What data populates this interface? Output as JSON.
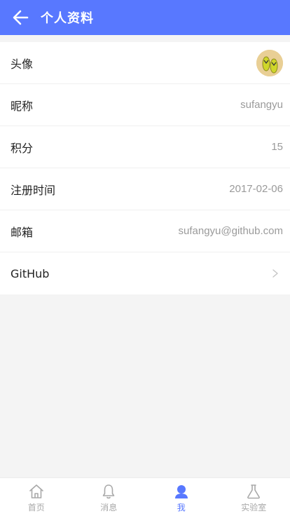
{
  "header": {
    "title": "个人资料",
    "background": "#5878ff"
  },
  "profile": {
    "rows": [
      {
        "label": "头像",
        "type": "avatar"
      },
      {
        "label": "昵称",
        "value": "sufangyu"
      },
      {
        "label": "积分",
        "value": "15"
      },
      {
        "label": "注册时间",
        "value": "2017-02-06"
      },
      {
        "label": "邮箱",
        "value": "sufangyu@github.com"
      },
      {
        "label": "GitHub",
        "type": "link"
      }
    ]
  },
  "tabbar": {
    "active": "我",
    "items": [
      {
        "label": "首页",
        "icon": "home-icon"
      },
      {
        "label": "消息",
        "icon": "bell-icon"
      },
      {
        "label": "我",
        "icon": "user-icon"
      },
      {
        "label": "实验室",
        "icon": "flask-icon"
      }
    ]
  },
  "colors": {
    "accent": "#5878ff",
    "tab_inactive": "#a8a8a8",
    "value_text": "#9a9a9a"
  }
}
